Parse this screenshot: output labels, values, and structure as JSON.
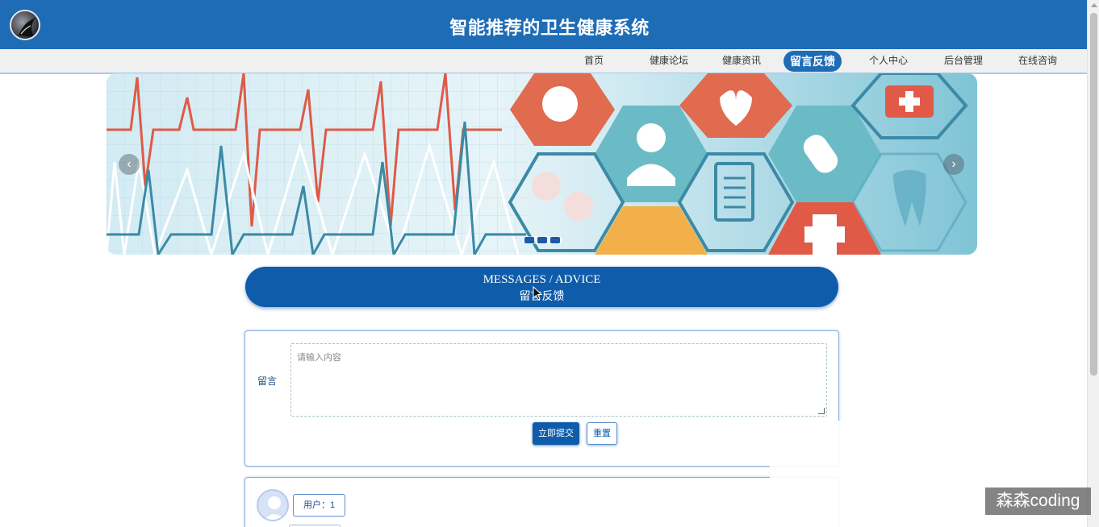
{
  "header": {
    "title": "智能推荐的卫生健康系统",
    "logo_icon": "logo-avatar-icon"
  },
  "nav": {
    "items": [
      {
        "label": "首页",
        "active": false
      },
      {
        "label": "健康论坛",
        "active": false
      },
      {
        "label": "健康资讯",
        "active": false
      },
      {
        "label": "留言反馈",
        "active": true
      },
      {
        "label": "个人中心",
        "active": false
      },
      {
        "label": "后台管理",
        "active": false
      },
      {
        "label": "在线咨询",
        "active": false
      }
    ]
  },
  "banner": {
    "prev_icon": "‹",
    "next_icon": "›",
    "slide_count": 3
  },
  "section": {
    "title_en": "MESSAGES / ADVICE",
    "title_zh": "留言反馈"
  },
  "form": {
    "label": "留言",
    "placeholder": "请输入内容",
    "submit_label": "立即提交",
    "reset_label": "重置"
  },
  "comments": [
    {
      "user_label": "用户：1"
    }
  ],
  "watermark": "森森coding",
  "colors": {
    "primary": "#1e6cb5",
    "button": "#0f5cab",
    "nav_bg": "#f0f0f0"
  }
}
